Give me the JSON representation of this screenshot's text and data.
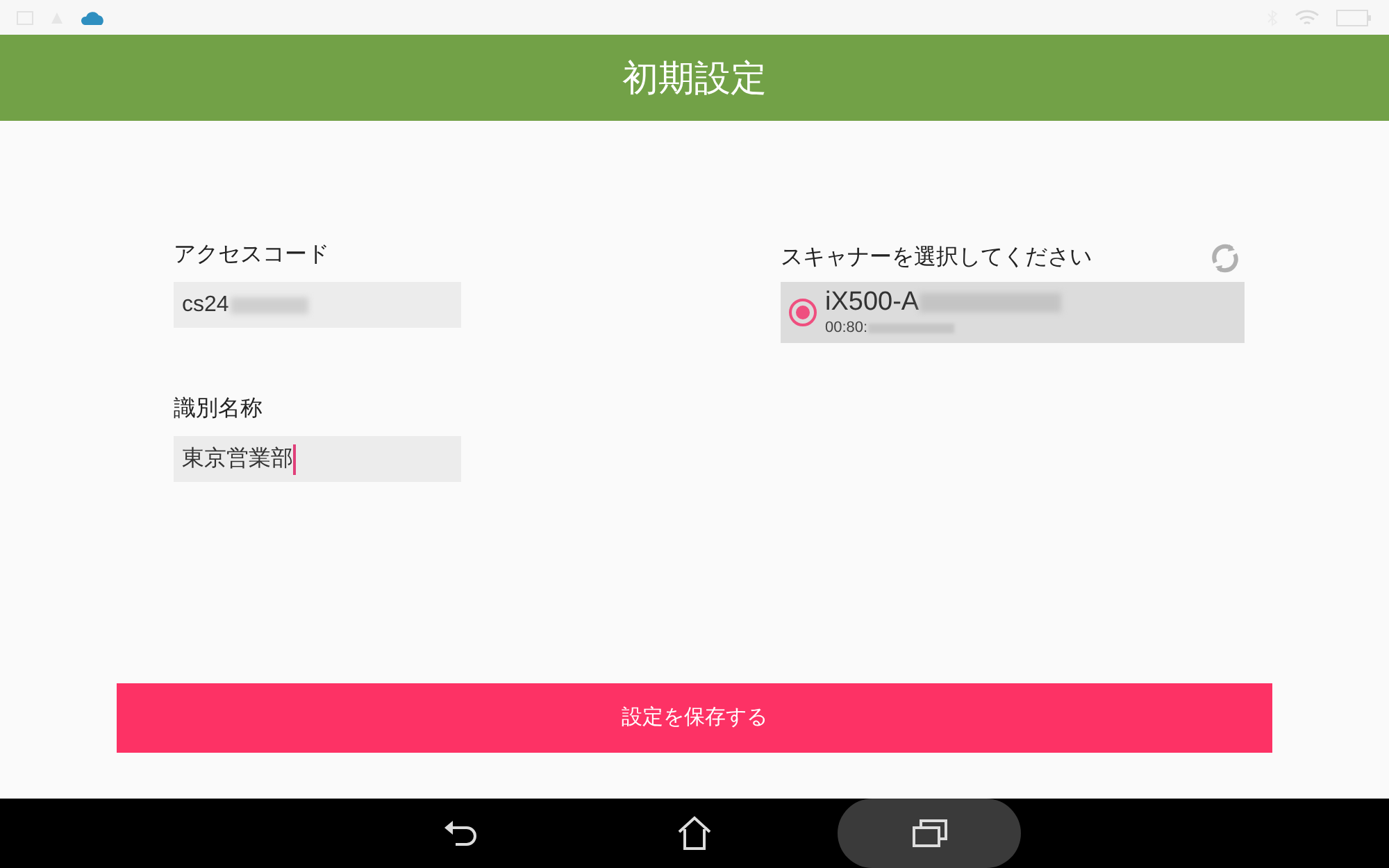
{
  "app_bar": {
    "title": "初期設定"
  },
  "fields": [
    {
      "label": "アクセスコード",
      "value": "cs24",
      "redacted": true,
      "focused": false
    },
    {
      "label": "識別名称",
      "value": "東京営業部",
      "redacted": false,
      "focused": true
    }
  ],
  "scanners": {
    "heading": "スキャナーを選択してください",
    "items": [
      {
        "name": "iX500-A",
        "address": "00:80:",
        "selected": true
      }
    ]
  },
  "save_button": {
    "label": "設定を保存する"
  }
}
